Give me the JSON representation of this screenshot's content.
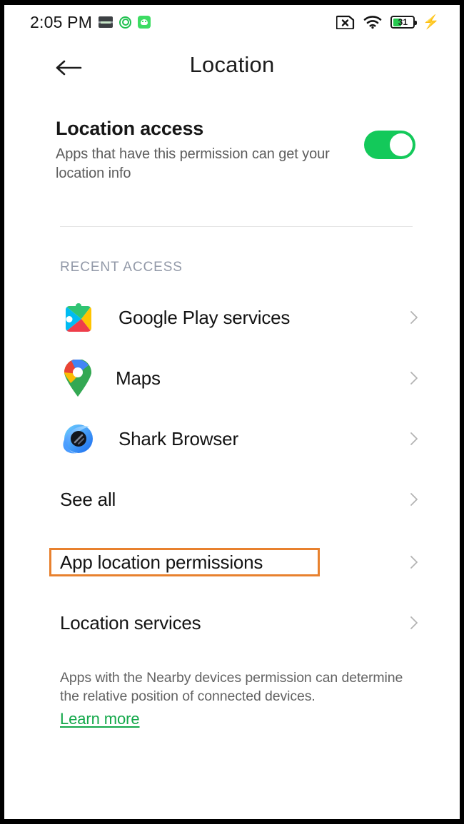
{
  "status_bar": {
    "time": "2:05 PM",
    "notification_icons": [
      "sim-card-icon",
      "location-target-icon",
      "green-app-icon"
    ],
    "sim_icon": "sim-off-icon",
    "wifi_icon": "wifi-icon",
    "battery_level": "31",
    "battery_charging_icon": "charging-bolt-icon"
  },
  "app_bar": {
    "back_icon": "back-arrow-icon",
    "title": "Location"
  },
  "location_access": {
    "title": "Location access",
    "subtitle": "Apps that have this permission can get your location info",
    "toggle_state": "on"
  },
  "recent_access": {
    "section_label": "RECENT ACCESS",
    "apps": [
      {
        "name": "Google Play services",
        "icon": "google-play-services-icon"
      },
      {
        "name": "Maps",
        "icon": "google-maps-icon"
      },
      {
        "name": "Shark Browser",
        "icon": "shark-browser-icon"
      }
    ],
    "see_all_label": "See all"
  },
  "menu": {
    "app_location_permissions": "App location permissions",
    "location_services": "Location services"
  },
  "footer": {
    "note": "Apps with the Nearby devices permission can determine the relative position of connected devices.",
    "learn_more": "Learn more"
  },
  "colors": {
    "toggle_on": "#13c95a",
    "highlight_box": "#e8812e",
    "link_green": "#13a84a",
    "section_label": "#9299a8"
  }
}
